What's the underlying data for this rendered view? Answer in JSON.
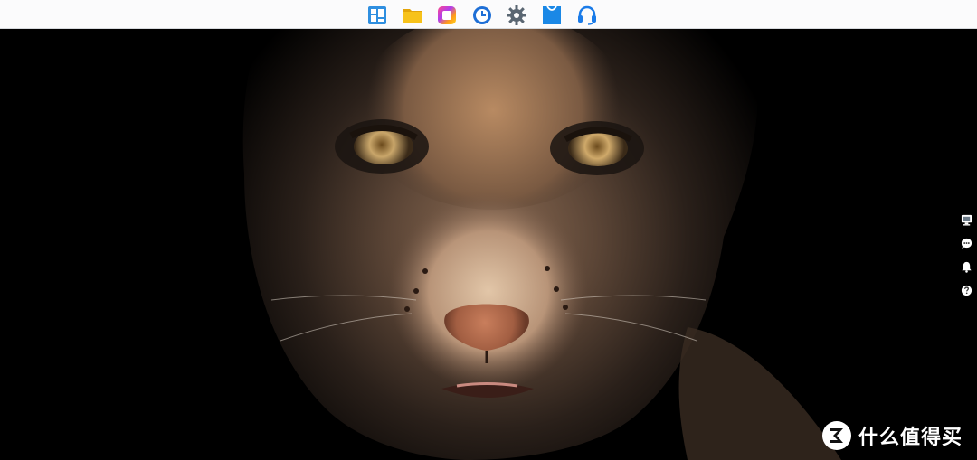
{
  "dock": {
    "background": "#fbfbfc",
    "apps": [
      {
        "icon": "main-menu-icon",
        "color": "#2f8fe0"
      },
      {
        "icon": "file-station-icon",
        "color": "#f5b50a"
      },
      {
        "icon": "photos-icon",
        "color": "#b03cf0"
      },
      {
        "icon": "clock-backup-icon",
        "color": "#1e6fd6"
      },
      {
        "icon": "control-panel-gear-icon",
        "color": "#5a6672"
      },
      {
        "icon": "package-center-icon",
        "color": "#1a88e6"
      },
      {
        "icon": "support-headset-icon",
        "color": "#1a7be8"
      }
    ]
  },
  "side_widgets": [
    {
      "icon": "system-health-monitor-icon"
    },
    {
      "icon": "chat-message-icon"
    },
    {
      "icon": "notification-bell-icon"
    },
    {
      "icon": "help-question-icon"
    }
  ],
  "wallpaper": {
    "subject": "lynx-face-photo",
    "background_color": "#000000"
  },
  "watermark": {
    "text": "什么值得买",
    "logo_icon": "smzdm-logo-icon"
  }
}
